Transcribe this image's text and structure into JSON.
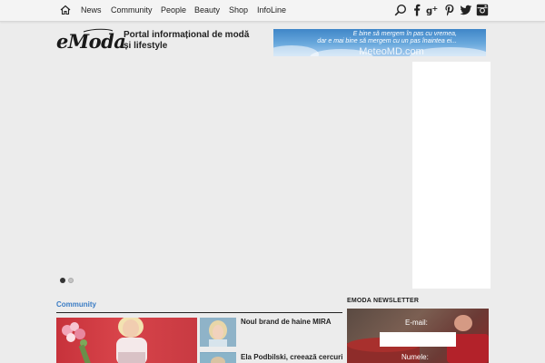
{
  "nav": {
    "home_icon": "home-icon",
    "items": [
      "News",
      "Community",
      "People",
      "Beauty",
      "Shop",
      "InfoLine"
    ],
    "social_icons": [
      "search-icon",
      "facebook-icon",
      "google-plus-icon",
      "pinterest-icon",
      "twitter-icon",
      "instagram-icon"
    ]
  },
  "header": {
    "logo_text": "eModa",
    "tagline_line1": "Portal informațional de modă",
    "tagline_line2": "și lifestyle",
    "banner": {
      "line1": "E bine să mergem în pas cu vremea,",
      "line2": "dar e mai bine să mergem cu un pas înaintea ei...",
      "brand": "MeteoMD.com"
    }
  },
  "slider": {
    "dots": [
      {
        "active": true
      },
      {
        "active": false
      }
    ]
  },
  "community": {
    "label": "Community",
    "articles": [
      {
        "title": "Noul brand de haine MIRA"
      },
      {
        "title": "Ela Podbilski, creează cercuri"
      }
    ]
  },
  "newsletter": {
    "title": "EMODA NEWSLETTER",
    "email_label": "E-mail:",
    "name_label": "Numele:"
  },
  "colors": {
    "accent_blue": "#3a7cc4",
    "background": "#ececec"
  }
}
